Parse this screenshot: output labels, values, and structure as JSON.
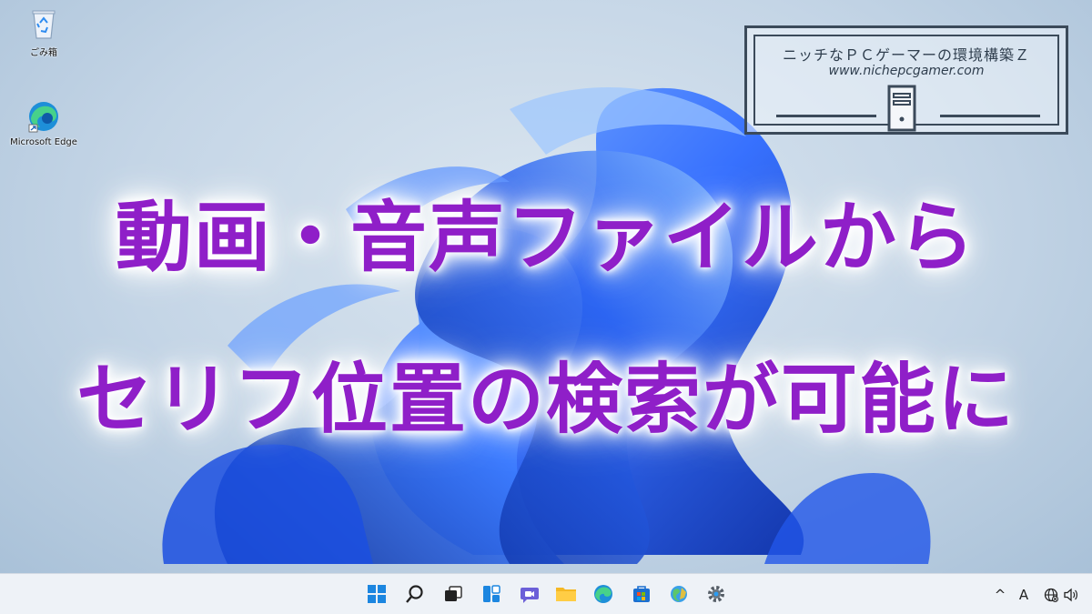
{
  "desktop": {
    "icons": [
      {
        "label": "ごみ箱",
        "icon": "recycle-bin-icon"
      },
      {
        "label": "Microsoft Edge",
        "icon": "edge-icon"
      }
    ]
  },
  "logo": {
    "line1": "ニッチなＰＣゲーマーの環境構築Ｚ",
    "line2": "www.nichepcgamer.com"
  },
  "headline": {
    "line1": "動画・音声ファイルから",
    "line2": "セリフ位置の検索が可能に",
    "color": "#8f1fc8"
  },
  "taskbar": {
    "apps": [
      "start-icon",
      "search-icon",
      "task-view-icon",
      "widgets-icon",
      "chat-icon",
      "file-explorer-icon",
      "edge-icon",
      "store-icon",
      "app-icon",
      "settings-icon"
    ],
    "tray": {
      "chevron": "^",
      "ime": "A"
    }
  }
}
